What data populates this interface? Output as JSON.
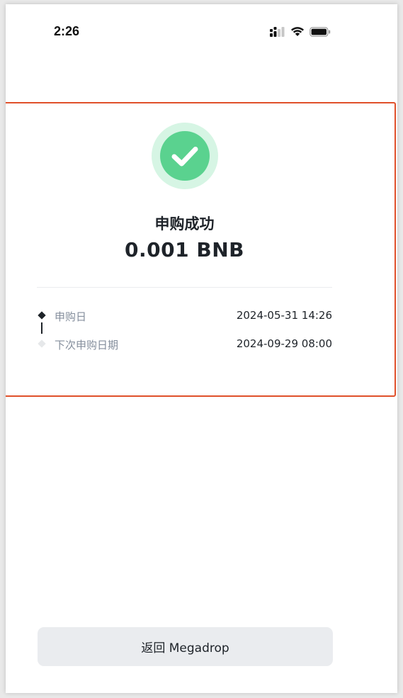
{
  "status_bar": {
    "time": "2:26",
    "icons": [
      "signal-icon",
      "wifi-icon",
      "battery-icon"
    ]
  },
  "result": {
    "title": "申购成功",
    "amount": "0.001 BNB",
    "icon": "check-circle-icon",
    "accent_color": "#5ad28f",
    "accent_light": "#d6f5e4"
  },
  "timeline": [
    {
      "label": "申购日",
      "value": "2024-05-31 14:26",
      "active": true
    },
    {
      "label": "下次申购日期",
      "value": "2024-09-29 08:00",
      "active": false
    }
  ],
  "footer": {
    "button_label": "返回 Megadrop"
  },
  "colors": {
    "highlight_border": "#e0502a",
    "text_primary": "#1e2329",
    "text_secondary": "#848e9c",
    "button_bg": "#eaecef"
  }
}
